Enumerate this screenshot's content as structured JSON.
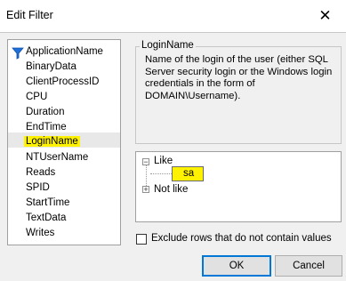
{
  "window": {
    "title": "Edit Filter",
    "close_glyph": "✕"
  },
  "columns": {
    "selected": "LoginName",
    "items": [
      {
        "label": "ApplicationName",
        "filtered": true
      },
      {
        "label": "BinaryData",
        "filtered": false
      },
      {
        "label": "ClientProcessID",
        "filtered": false
      },
      {
        "label": "CPU",
        "filtered": false
      },
      {
        "label": "Duration",
        "filtered": false
      },
      {
        "label": "EndTime",
        "filtered": false
      },
      {
        "label": "LoginName",
        "filtered": false,
        "selected": true
      },
      {
        "label": "NTUserName",
        "filtered": false
      },
      {
        "label": "Reads",
        "filtered": false
      },
      {
        "label": "SPID",
        "filtered": false
      },
      {
        "label": "StartTime",
        "filtered": false
      },
      {
        "label": "TextData",
        "filtered": false
      },
      {
        "label": "Writes",
        "filtered": false
      }
    ]
  },
  "description": {
    "group_title": "LoginName",
    "text": "Name of the login of the user (either SQL Server security login or the Windows login credentials in the form of DOMAIN\\Username)."
  },
  "conditions": {
    "like": {
      "label": "Like",
      "toggle": "−",
      "value": "sa"
    },
    "not_like": {
      "label": "Not like",
      "toggle": "+"
    }
  },
  "exclude_rows": {
    "label": "Exclude rows that do not contain values",
    "checked": false
  },
  "buttons": {
    "ok": "OK",
    "cancel": "Cancel"
  },
  "colors": {
    "highlight": "#fff200",
    "filter_icon": "#1e6fd9",
    "default_button_border": "#0078d7"
  }
}
